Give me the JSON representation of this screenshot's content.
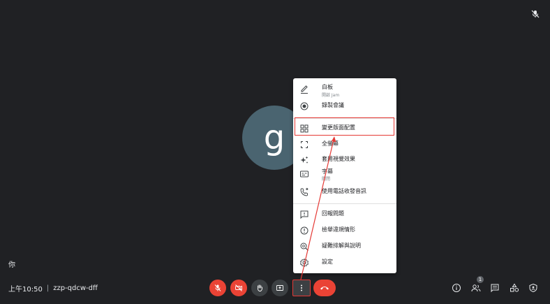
{
  "corner": {
    "icon": "mic-off-icon"
  },
  "participant": {
    "avatar_letter": "g",
    "self_label": "你"
  },
  "meeting": {
    "time": "上午10:50",
    "separator": "|",
    "code": "zzp-qdcw-dff"
  },
  "controls": {
    "mic": {
      "icon": "mic-off-icon"
    },
    "camera": {
      "icon": "camera-off-icon"
    },
    "hand": {
      "icon": "hand-icon"
    },
    "present": {
      "icon": "present-icon"
    },
    "more": {
      "icon": "more-vert-icon"
    },
    "hangup": {
      "icon": "hangup-icon"
    }
  },
  "right_controls": {
    "people_count": "1",
    "icons": [
      "info-icon",
      "people-icon",
      "chat-icon",
      "activities-icon",
      "host-controls-icon"
    ]
  },
  "menu": {
    "items": [
      {
        "label": "白板",
        "sub": "開啟 Jam",
        "icon": "pencil-icon"
      },
      {
        "label": "錄製會議",
        "icon": "record-icon"
      },
      {
        "label": "變更版面配置",
        "icon": "layout-icon"
      },
      {
        "label": "全螢幕",
        "icon": "fullscreen-icon"
      },
      {
        "label": "套用視覺效果",
        "icon": "sparkle-icon"
      },
      {
        "label": "字幕",
        "sub": "關閉",
        "icon": "captions-icon"
      },
      {
        "label": "使用電話收發音訊",
        "icon": "phone-icon"
      },
      {
        "label": "回報問題",
        "icon": "feedback-icon"
      },
      {
        "label": "檢舉違規情形",
        "icon": "report-icon"
      },
      {
        "label": "疑難排解與說明",
        "icon": "help-icon"
      },
      {
        "label": "設定",
        "icon": "settings-icon"
      }
    ]
  },
  "colors": {
    "background": "#202124",
    "red": "#ea4335",
    "annotation": "#e53935",
    "avatar": "#4a6470"
  }
}
